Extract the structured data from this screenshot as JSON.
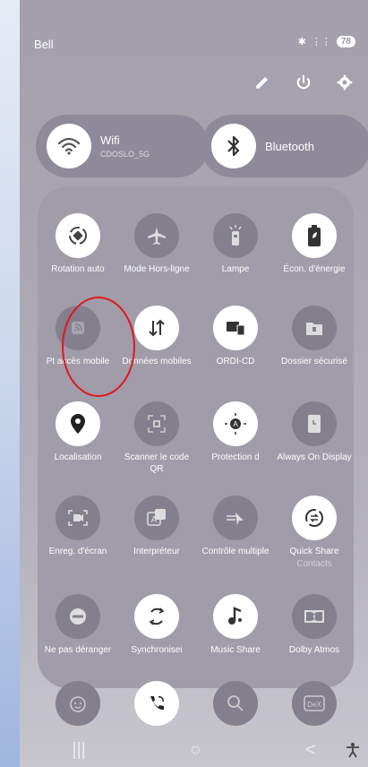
{
  "status": {
    "carrier": "Bell",
    "battery": "78"
  },
  "wifi": {
    "label": "Wifi",
    "network": "CDOSLO_5G"
  },
  "bluetooth": {
    "label": "Bluetooth"
  },
  "tiles": [
    {
      "label": "Rotation auto",
      "state": "on"
    },
    {
      "label": "Mode Hors-ligne",
      "state": "off"
    },
    {
      "label": "Lampe",
      "state": "off"
    },
    {
      "label": "Écon. d'énergie",
      "state": "on"
    },
    {
      "label": "Pt accès mobile",
      "state": "off"
    },
    {
      "label": "Données mobiles",
      "state": "on"
    },
    {
      "label": "ORDI-CD",
      "state": "on"
    },
    {
      "label": "Dossier sécurisé",
      "state": "off"
    },
    {
      "label": "Localisation",
      "state": "on"
    },
    {
      "label": "Scanner le code QR",
      "state": "off"
    },
    {
      "label": "Protection d",
      "state": "on"
    },
    {
      "label": "Always On Display",
      "state": "off"
    },
    {
      "label": "Enreg. d'écran",
      "state": "off"
    },
    {
      "label": "Interpréteur",
      "state": "off"
    },
    {
      "label": "Contrôle multiple",
      "state": "off"
    },
    {
      "label": "Quick Share",
      "sub": "Contacts",
      "state": "on"
    },
    {
      "label": "Ne pas déranger",
      "state": "off"
    },
    {
      "label": "Synchronisei",
      "state": "on"
    },
    {
      "label": "Music Share",
      "state": "on"
    },
    {
      "label": "Dolby Atmos",
      "state": "off"
    },
    {
      "label": "",
      "state": "off"
    },
    {
      "label": "",
      "state": "on"
    },
    {
      "label": "",
      "state": "off"
    },
    {
      "label": "DeX",
      "state": "off"
    }
  ]
}
